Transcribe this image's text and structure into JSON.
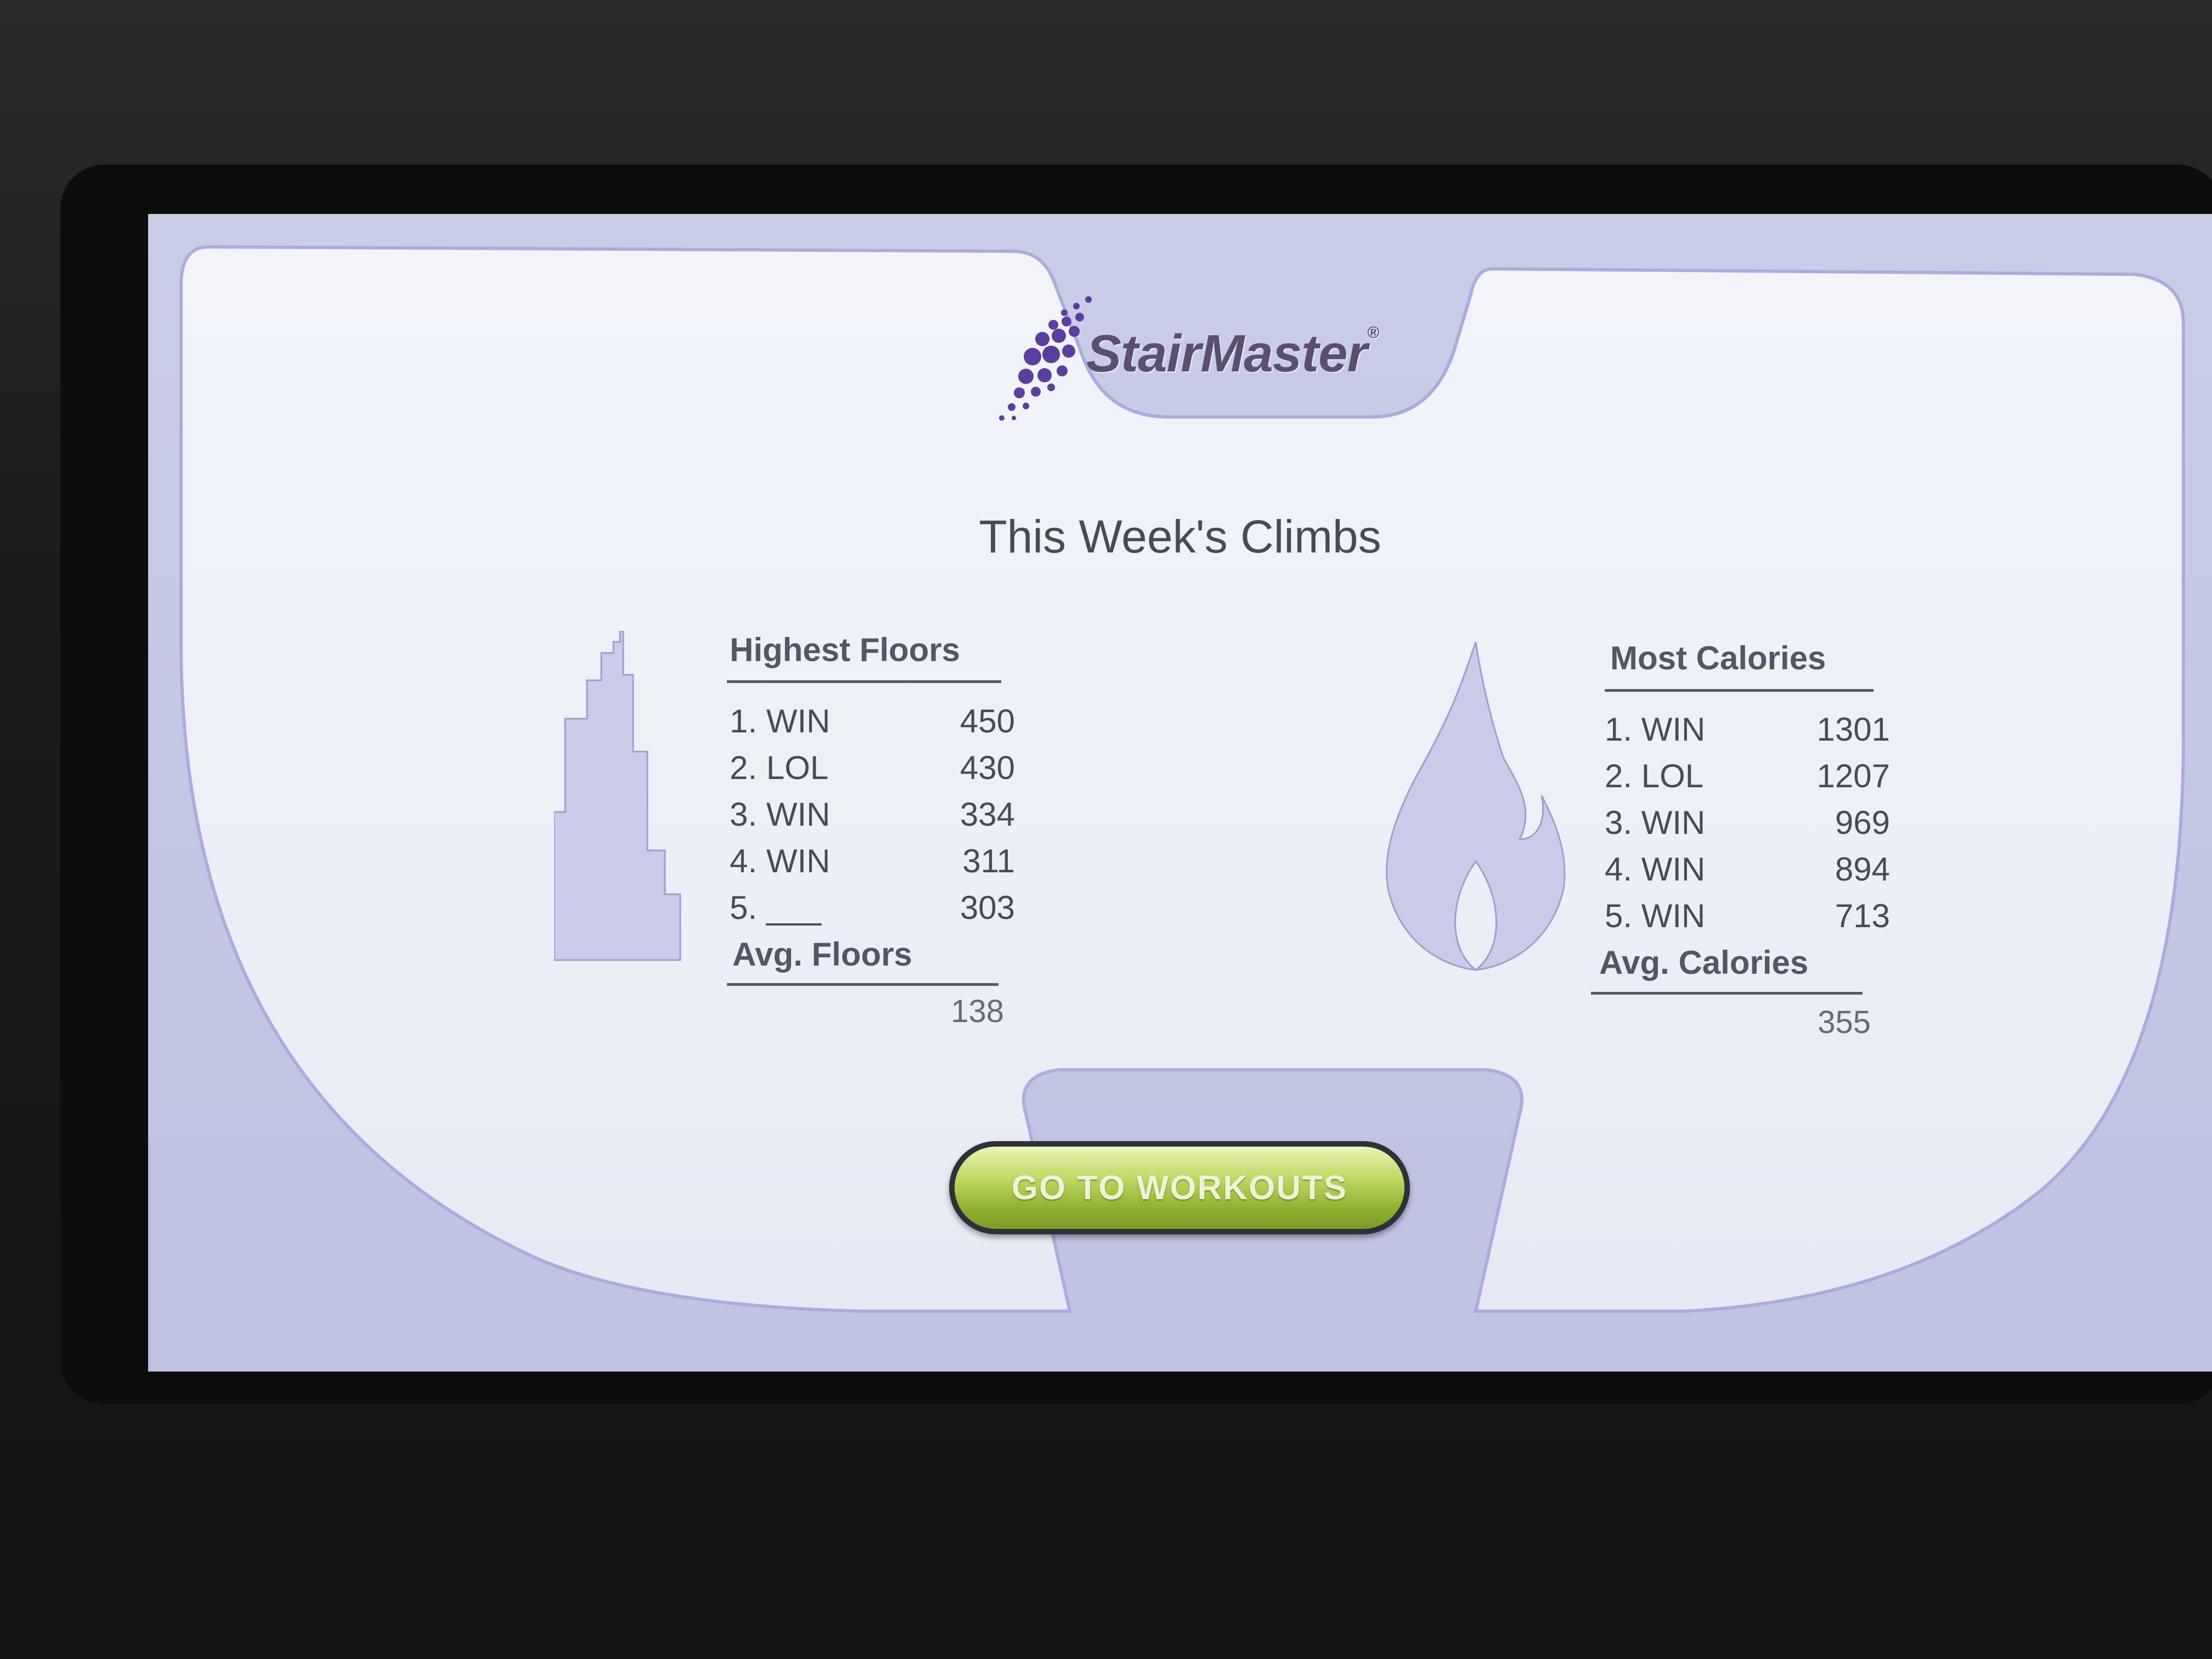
{
  "header": {
    "brand": "StairMaster",
    "brand_mark": "®"
  },
  "title": "This Week's Climbs",
  "floors": {
    "heading": "Highest Floors",
    "icon": "building-icon",
    "rows": [
      {
        "label": "1. WIN",
        "value": "450"
      },
      {
        "label": "2. LOL",
        "value": "430"
      },
      {
        "label": "3. WIN",
        "value": "334"
      },
      {
        "label": "4. WIN",
        "value": "311"
      },
      {
        "label": "5. ___",
        "value": "303"
      }
    ],
    "avg_heading": "Avg. Floors",
    "avg_value": "138"
  },
  "calories": {
    "heading": "Most Calories",
    "icon": "flame-icon",
    "rows": [
      {
        "label": "1. WIN",
        "value": "1301"
      },
      {
        "label": "2. LOL",
        "value": "1207"
      },
      {
        "label": "3. WIN",
        "value": "969"
      },
      {
        "label": "4. WIN",
        "value": "894"
      },
      {
        "label": "5. WIN",
        "value": "713"
      }
    ],
    "avg_heading": "Avg. Calories",
    "avg_value": "355"
  },
  "button": {
    "label": "GO TO WORKOUTS"
  },
  "colors": {
    "screen_frame": "#c2c6e3",
    "panel": "#eef0f8",
    "logo_dots": "#5b3f9e",
    "button_green": "#9fbf3a"
  }
}
